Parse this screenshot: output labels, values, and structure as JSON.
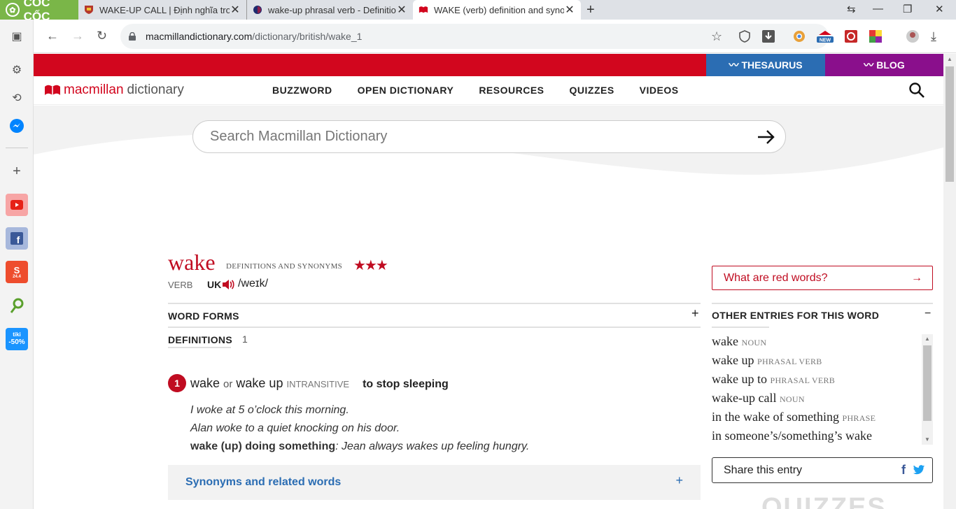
{
  "browser": {
    "logo_text": "CỐC CỐC",
    "tabs": [
      {
        "title": "WAKE-UP CALL | Định nghĩa trong Từ điển"
      },
      {
        "title": "wake-up phrasal verb - Definition"
      },
      {
        "title": "WAKE (verb) definition and synonyms"
      }
    ],
    "url_host": "macmillandictionary.com",
    "url_path": "/dictionary/british/wake_1"
  },
  "sidebar": {
    "items": [
      "toggle-panel",
      "settings",
      "history",
      "messenger",
      "add",
      "youtube",
      "facebook",
      "shopee",
      "app",
      "tiki"
    ],
    "tiki_label": "-50%",
    "shopee_label": "24.4"
  },
  "site": {
    "thesaurus": "THESAURUS",
    "blog": "BLOG",
    "logo_brand": "macmillan",
    "logo_dict": "dictionary",
    "nav": [
      "BUZZWORD",
      "OPEN DICTIONARY",
      "RESOURCES",
      "QUIZZES",
      "VIDEOS"
    ],
    "search_placeholder": "Search Macmillan Dictionary",
    "colors": {
      "brand_red": "#d2061e",
      "thesaurus_blue": "#2b6db3",
      "blog_purple": "#8a0f8c"
    }
  },
  "entry": {
    "headword": "wake",
    "subtitle": "DEFINITIONS AND SYNONYMS",
    "stars": "★★★",
    "pos": "VERB",
    "region": "UK",
    "pronunciation": "/weɪk/",
    "word_forms_label": "WORD FORMS",
    "definitions_label": "DEFINITIONS",
    "definitions_count": "1",
    "sense": {
      "number": "1",
      "word1": "wake",
      "or": "or",
      "word2": "wake up",
      "grammar": "INTRANSITIVE",
      "definition": "to stop sleeping",
      "examples": [
        "I woke at 5 o’clock this morning.",
        "Alan woke to a quiet knocking on his door."
      ],
      "pattern": "wake (up) doing something",
      "pattern_example": ": Jean always wakes up feeling hungry."
    },
    "synonyms_label": "Synonyms and related words"
  },
  "right": {
    "red_words": "What are red words?",
    "other_entries_label": "OTHER ENTRIES FOR THIS WORD",
    "other_entries": [
      {
        "word": "wake",
        "tag": "NOUN"
      },
      {
        "word": "wake up",
        "tag": "PHRASAL VERB"
      },
      {
        "word": "wake up to",
        "tag": "PHRASAL VERB"
      },
      {
        "word": "wake-up call",
        "tag": "NOUN"
      },
      {
        "word": "in the wake of something",
        "tag": "PHRASE"
      },
      {
        "word": "in someone’s/something’s wake",
        "tag": ""
      }
    ],
    "share_label": "Share this entry",
    "quizzes_peek": "QUIZZES"
  }
}
